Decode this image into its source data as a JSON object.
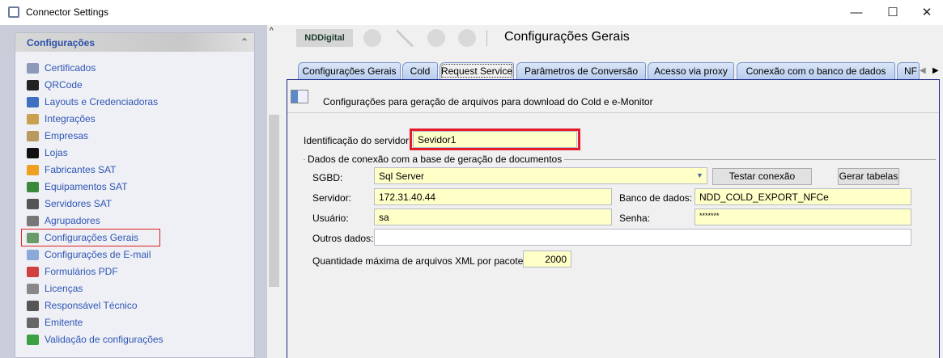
{
  "window": {
    "title": "Connector Settings",
    "minimize": "—",
    "maximize": "☐",
    "close": "✕"
  },
  "sidebar": {
    "header": "Configurações",
    "collapse": "⌃",
    "items": [
      {
        "label": "Certificados",
        "color": "#8a9ab8"
      },
      {
        "label": "QRCode",
        "color": "#222"
      },
      {
        "label": "Layouts e Credenciadoras",
        "color": "#3f6fc0"
      },
      {
        "label": "Integrações",
        "color": "#c8a050"
      },
      {
        "label": "Empresas",
        "color": "#b89a60"
      },
      {
        "label": "Lojas",
        "color": "#111"
      },
      {
        "label": "Fabricantes SAT",
        "color": "#f0a020"
      },
      {
        "label": "Equipamentos SAT",
        "color": "#3a8a3a"
      },
      {
        "label": "Servidores SAT",
        "color": "#555"
      },
      {
        "label": "Agrupadores",
        "color": "#777"
      },
      {
        "label": "Configurações Gerais",
        "color": "#6a9a6a",
        "selected": true
      },
      {
        "label": "Configurações de E-mail",
        "color": "#8aa8d8"
      },
      {
        "label": "Formulários PDF",
        "color": "#d04040"
      },
      {
        "label": "Licenças",
        "color": "#888"
      },
      {
        "label": "Responsável Técnico",
        "color": "#555"
      },
      {
        "label": "Emitente",
        "color": "#666"
      },
      {
        "label": "Validação de configurações",
        "color": "#3aa040"
      }
    ]
  },
  "toolbar": {
    "logo": "NDDigital",
    "title": "Configurações Gerais"
  },
  "tabs": [
    "Configurações Gerais",
    "Cold",
    "Request Service",
    "Parâmetros de Conversão",
    "Acesso via proxy",
    "Conexão com o banco de dados",
    "NF"
  ],
  "content": {
    "description": "Configurações para geração de arquivos para download do Cold e e-Monitor",
    "server_id_label": "Identificação do servidor:",
    "server_id": "Sevidor1",
    "group_label": "Dados de conexão com a base de geração de documentos",
    "sgbd_label": "SGBD:",
    "sgbd": "Sql Server",
    "test_btn": "Testar conexão",
    "gen_btn": "Gerar tabelas",
    "server_label": "Servidor:",
    "server": "172.31.40.44",
    "db_label": "Banco de dados:",
    "db": "NDD_COLD_EXPORT_NFCe",
    "user_label": "Usuário:",
    "user": "sa",
    "pass_label": "Senha:",
    "pass": "*******",
    "other_label": "Outros dados:",
    "other": "",
    "max_label": "Quantidade máxima de arquivos  XML por pacote:",
    "max": "2000"
  }
}
